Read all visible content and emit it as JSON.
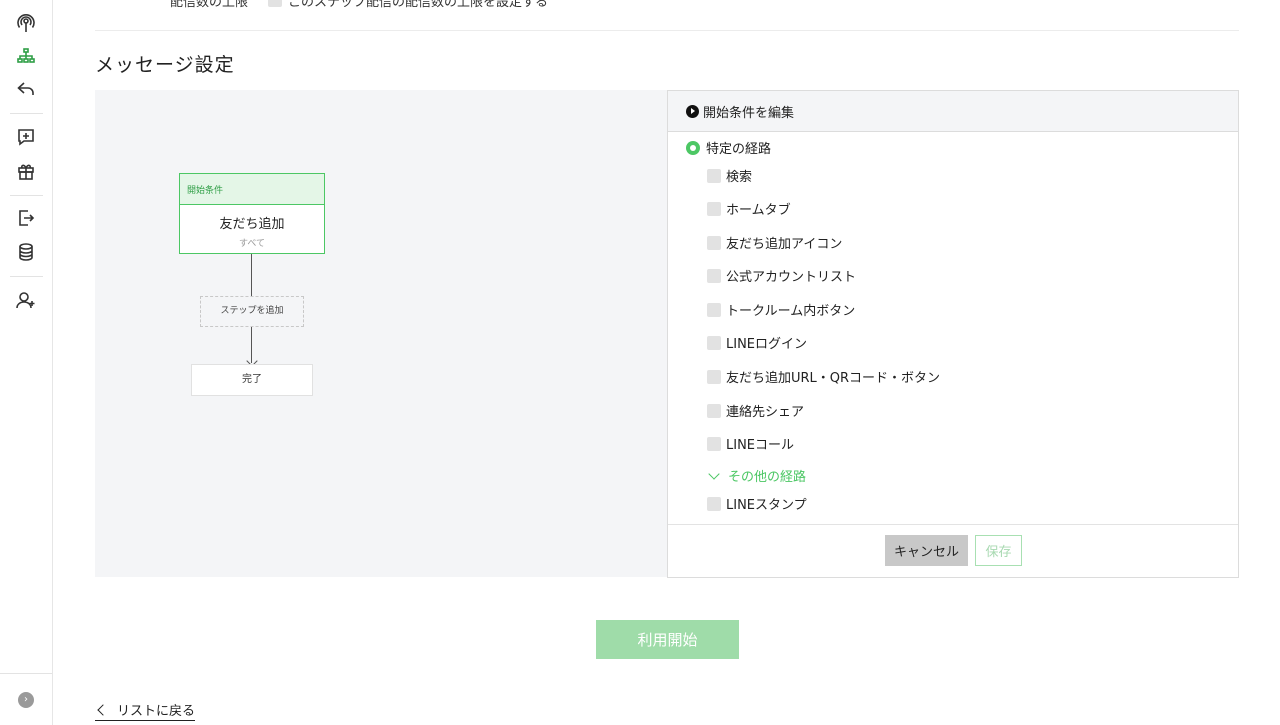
{
  "top_row": {
    "label": "配信数の上限",
    "checkbox_label": "このステップ配信の配信数の上限を設定する"
  },
  "section_title": "メッセージ設定",
  "flow": {
    "start_header": "開始条件",
    "start_name": "友だち追加",
    "start_sub": "すべて",
    "add_step": "ステップを追加",
    "end": "完了"
  },
  "editor": {
    "header": "開始条件を編集",
    "radio_label": "特定の経路",
    "options": [
      "検索",
      "ホームタブ",
      "友だち追加アイコン",
      "公式アカウントリスト",
      "トークルーム内ボタン",
      "LINEログイン",
      "友だち追加URL・QRコード・ボタン",
      "連絡先シェア",
      "LINEコール"
    ],
    "more_label": "その他の経路",
    "more_options": [
      "LINEスタンプ"
    ],
    "cancel": "キャンセル",
    "save": "保存"
  },
  "start_button": "利用開始",
  "back_link": "リストに戻る",
  "sidebar_icons": [
    "broadcast-icon",
    "flow-icon",
    "reply-icon",
    "add-message-icon",
    "gift-icon",
    "data-export-icon",
    "database-icon",
    "add-friend-icon"
  ],
  "colors": {
    "accent": "#4cc764",
    "accent_light": "#9fdca9"
  }
}
